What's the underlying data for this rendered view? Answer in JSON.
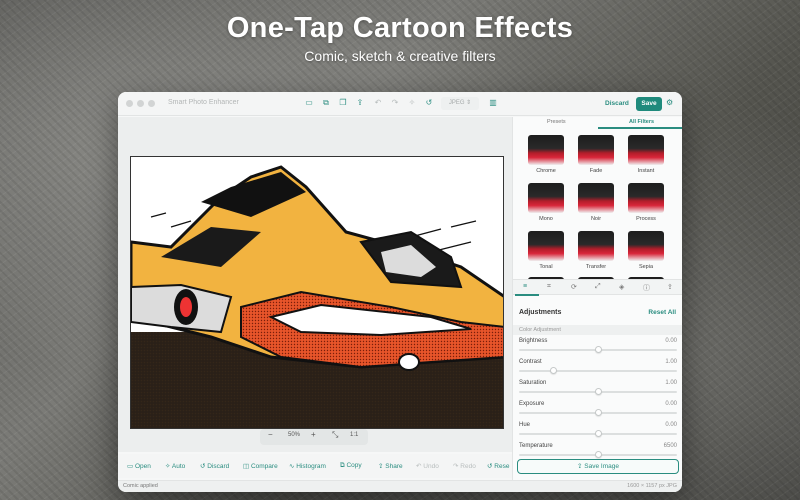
{
  "hero": {
    "title": "One-Tap Cartoon Effects",
    "subtitle": "Comic, sketch & creative filters"
  },
  "window": {
    "app_title": "Smart Photo Enhancer",
    "format": "JPEG ⇕",
    "discard_label": "Discard",
    "save_label": "Save",
    "toolbar_icons": [
      "open-folder-icon",
      "copy-icon",
      "duplicate-icon",
      "share-icon",
      "undo-icon",
      "redo-icon",
      "magic-icon",
      "revert-icon"
    ]
  },
  "zoom": {
    "out": "−",
    "level": "50%",
    "in": "+",
    "fit": "⤡",
    "actual": "1:1"
  },
  "bottom_toolbar": {
    "open": "Open",
    "auto": "Auto",
    "discard": "Discard",
    "compare": "Compare",
    "histogram": "Histogram",
    "copy": "Copy",
    "share": "Share",
    "undo": "Undo",
    "redo": "Redo",
    "reset": "Rese"
  },
  "status": {
    "left": "Comic applied",
    "right": "1600 × 1157 px  JPG"
  },
  "panel": {
    "tabs": [
      "Presets",
      "All Filters"
    ],
    "active_tab": "All Filters",
    "filters": [
      "Chrome",
      "Fade",
      "Instant",
      "Mono",
      "Noir",
      "Process",
      "Tonal",
      "Transfer",
      "Sepia"
    ],
    "adjustments_title": "Adjustments",
    "reset_all": "Reset All",
    "section": "Color Adjustment",
    "sliders": [
      {
        "label": "Brightness",
        "value": "0.00",
        "level": 0.5
      },
      {
        "label": "Contrast",
        "value": "1.00",
        "level": 0.22
      },
      {
        "label": "Saturation",
        "value": "1.00",
        "level": 0.5
      },
      {
        "label": "Exposure",
        "value": "0.00",
        "level": 0.5
      },
      {
        "label": "Hue",
        "value": "0.00",
        "level": 0.5
      },
      {
        "label": "Temperature",
        "value": "6500",
        "level": 0.5
      }
    ],
    "save_image": "Save Image"
  }
}
